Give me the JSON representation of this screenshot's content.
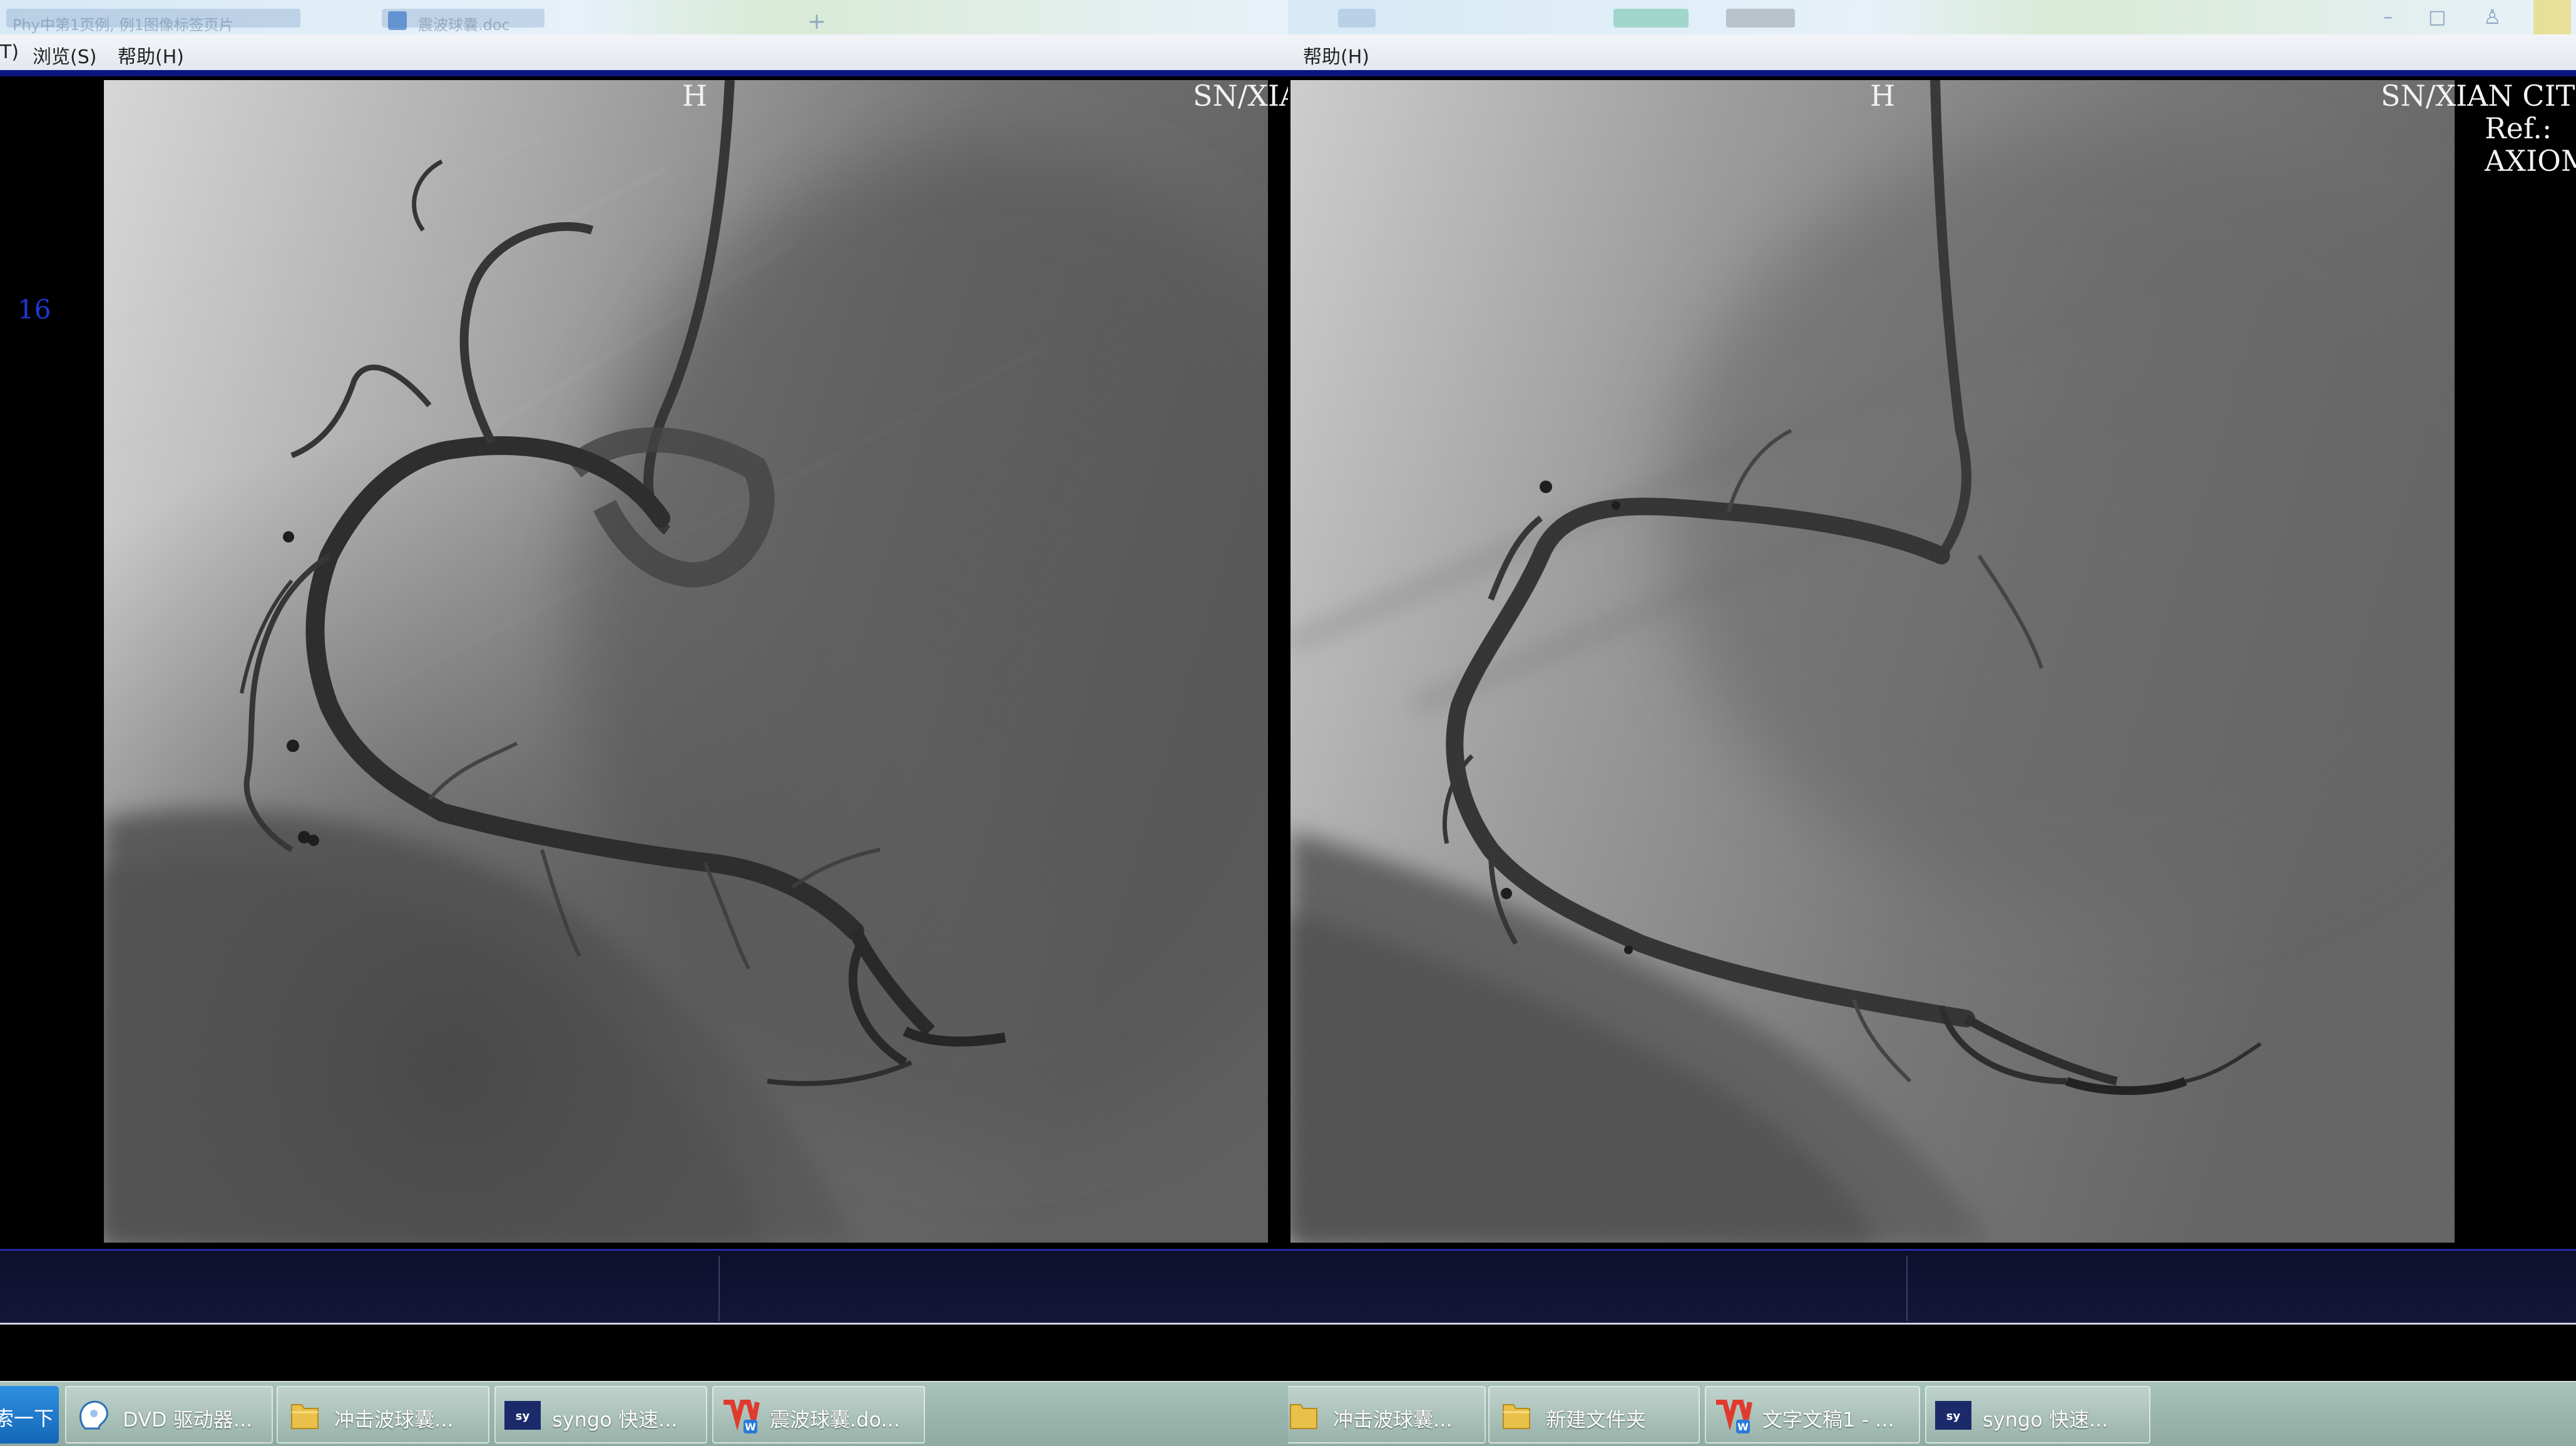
{
  "left_window": {
    "title_strip": {
      "tabs": [
        {
          "text": "Phy中第1页例, 例1图像标签页片"
        },
        {
          "text": "震波球囊.doc"
        }
      ]
    },
    "menu": {
      "items": [
        {
          "label": "T)"
        },
        {
          "label": "浏览(S)"
        },
        {
          "label": "帮助(H)"
        }
      ]
    },
    "overlay": {
      "orientation": "H",
      "institution": "SN/XIA",
      "frame_number": "16"
    }
  },
  "right_window": {
    "menu": {
      "items": [
        {
          "label": "帮助(H)"
        }
      ]
    },
    "overlay": {
      "orientation": "H",
      "institution": "SN/XIAN CIT",
      "ref": "Ref.:",
      "device": "AXIOM"
    }
  },
  "taskbar": {
    "start_label": "索一下",
    "left_items": [
      {
        "label": "DVD 驱动器...",
        "icon": "dvd-drive-icon"
      },
      {
        "label": "冲击波球囊...",
        "icon": "folder-icon"
      },
      {
        "label": "syngo 快速...",
        "icon": "syngo-icon"
      },
      {
        "label": "震波球囊.do...",
        "icon": "wps-writer-icon"
      }
    ],
    "right_items": [
      {
        "label": "冲击波球囊...",
        "icon": "folder-icon"
      },
      {
        "label": "新建文件夹",
        "icon": "folder-icon"
      },
      {
        "label": "文字文稿1 - ...",
        "icon": "wps-writer-icon"
      },
      {
        "label": "syngo 快速...",
        "icon": "syngo-icon"
      }
    ]
  },
  "colors": {
    "accent_blue": "#0b1680",
    "frame_number": "#1f39d6",
    "taskbar": "#9ab6ac"
  }
}
